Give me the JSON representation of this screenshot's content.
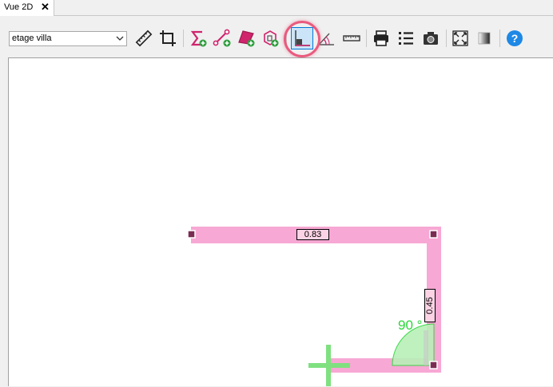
{
  "tabs": [
    {
      "label": "Vue 2D",
      "close_glyph": "✕"
    }
  ],
  "toolbar": {
    "level_select": {
      "value": "etage villa"
    },
    "tools": [
      {
        "name": "measure-ruler-icon"
      },
      {
        "name": "crop-icon"
      },
      {
        "name": "add-sum-icon"
      },
      {
        "name": "add-segment-icon"
      },
      {
        "name": "add-polygon-icon"
      },
      {
        "name": "add-3d-box-icon"
      },
      {
        "name": "right-angle-icon",
        "active": true
      },
      {
        "name": "angle-protractor-icon"
      },
      {
        "name": "scale-ruler-icon"
      },
      {
        "name": "print-icon"
      },
      {
        "name": "list-icon"
      },
      {
        "name": "camera-icon"
      },
      {
        "name": "fit-to-screen-icon"
      },
      {
        "name": "gradient-icon"
      },
      {
        "name": "help-icon"
      }
    ]
  },
  "colors": {
    "wall": "#f7a8d4",
    "node": "#7a2d52",
    "angle_fill": "#b8f0b8",
    "angle_stroke": "#2bd63a",
    "cursor": "#7fe07f",
    "highlight": "#ea5a7e"
  },
  "drawing": {
    "dimensions": [
      {
        "label": "0.83"
      },
      {
        "label": "0.45"
      }
    ],
    "angle_label": "90 °"
  }
}
